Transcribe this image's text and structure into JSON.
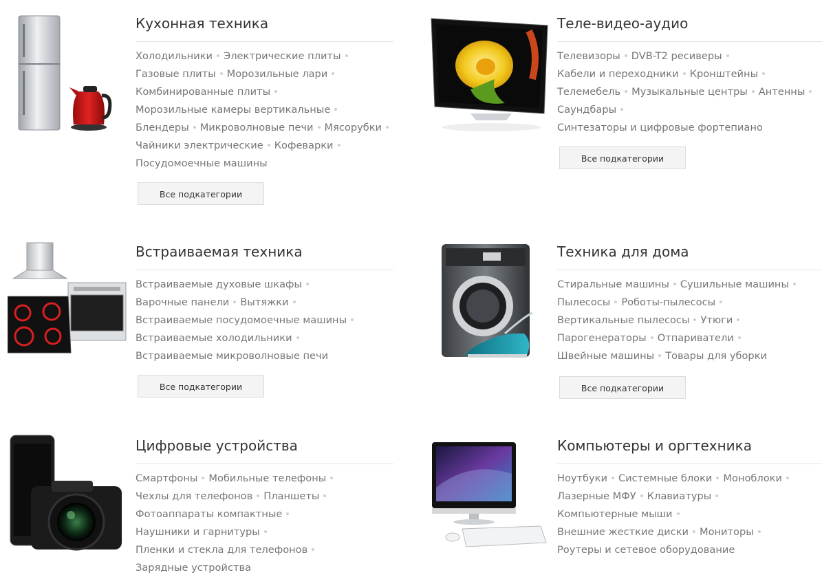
{
  "button_label": "Все подкатегории",
  "categories": [
    {
      "title": "Кухонная техника",
      "lines": [
        [
          "Холодильники",
          "Электрические плиты"
        ],
        [
          "Газовые плиты",
          "Морозильные лари"
        ],
        [
          "Комбинированные плиты"
        ],
        [
          "Морозильные камеры вертикальные"
        ],
        [
          "Блендеры",
          "Микроволновые печи",
          "Мясорубки"
        ],
        [
          "Чайники электрические",
          "Кофеварки"
        ],
        [
          "Посудомоечные машины"
        ]
      ]
    },
    {
      "title": "Теле-видео-аудио",
      "lines": [
        [
          "Телевизоры",
          "DVB-T2 ресиверы"
        ],
        [
          "Кабели и переходники",
          "Кронштейны"
        ],
        [
          "Телемебель",
          "Музыкальные центры",
          "Антенны"
        ],
        [
          "Саундбары"
        ],
        [
          "Синтезаторы и цифровые фортепиано"
        ]
      ]
    },
    {
      "title": "Встраиваемая техника",
      "lines": [
        [
          "Встраиваемые духовые шкафы"
        ],
        [
          "Варочные панели",
          "Вытяжки"
        ],
        [
          "Встраиваемые посудомоечные машины"
        ],
        [
          "Встраиваемые холодильники"
        ],
        [
          "Встраиваемые микроволновые печи"
        ]
      ]
    },
    {
      "title": "Техника для дома",
      "lines": [
        [
          "Стиральные машины",
          "Сушильные машины"
        ],
        [
          "Пылесосы",
          "Роботы-пылесосы"
        ],
        [
          "Вертикальные пылесосы",
          "Утюги"
        ],
        [
          "Парогенераторы",
          "Отпариватели"
        ],
        [
          "Швейные машины",
          "Товары для уборки"
        ]
      ]
    },
    {
      "title": "Цифровые устройства",
      "lines": [
        [
          "Смартфоны",
          "Мобильные телефоны"
        ],
        [
          "Чехлы для телефонов",
          "Планшеты"
        ],
        [
          "Фотоаппараты компактные"
        ],
        [
          "Наушники и гарнитуры"
        ],
        [
          "Пленки и стекла для телефонов"
        ],
        [
          "Зарядные устройства"
        ]
      ]
    },
    {
      "title": "Компьютеры и оргтехника",
      "lines": [
        [
          "Ноутбуки",
          "Системные блоки",
          "Моноблоки"
        ],
        [
          "Лазерные МФУ",
          "Клавиатуры"
        ],
        [
          "Компьютерные мыши"
        ],
        [
          "Внешние жесткие диски",
          "Мониторы"
        ],
        [
          "Роутеры и сетевое оборудование"
        ]
      ]
    }
  ],
  "icons": [
    "fridge-kettle-image",
    "tv-image",
    "builtin-appliances-image",
    "washing-machine-iron-image",
    "phone-camera-image",
    "all-in-one-pc-image"
  ],
  "colors": {
    "title": "#333333",
    "link": "#767676",
    "dot": "#cfcfcf",
    "button_bg": "#f4f4f4",
    "divider": "#e3e3e3"
  }
}
